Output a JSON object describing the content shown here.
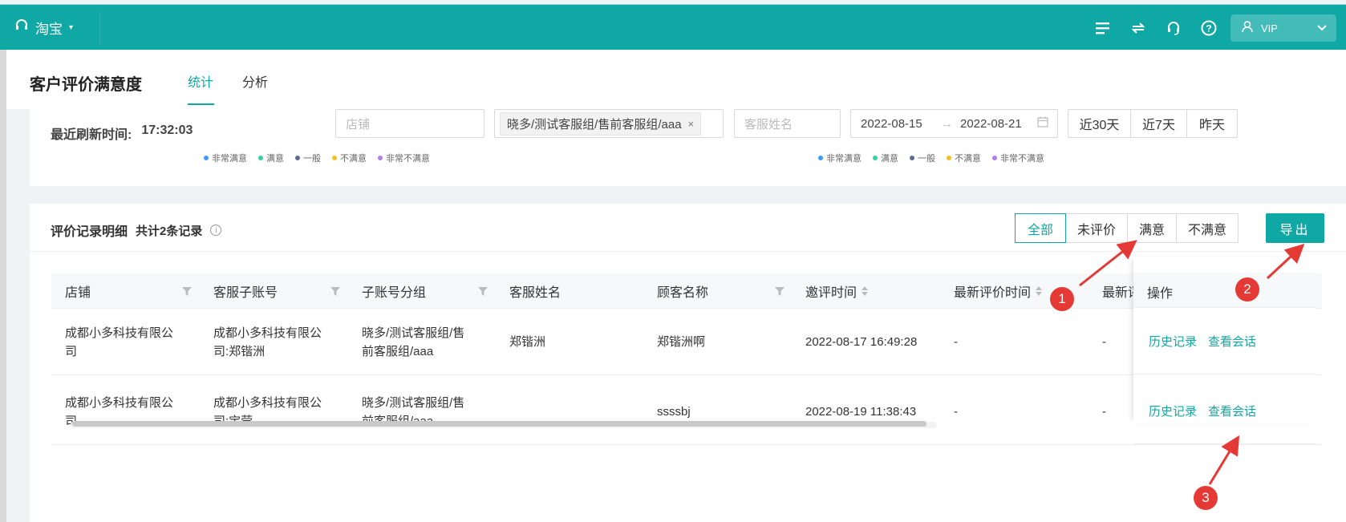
{
  "topbar": {
    "brand": "淘宝",
    "icons": [
      "list-icon",
      "swap-icon",
      "headset-icon",
      "help-icon"
    ],
    "user": "VIP",
    "color": "#0fa8a5"
  },
  "header": {
    "title": "客户评价满意度",
    "tabs": [
      {
        "label": "统计",
        "active": true
      },
      {
        "label": "分析",
        "active": false
      }
    ]
  },
  "filters": {
    "refresh_label": "最近刷新时间:",
    "refresh_time": "17:32:03",
    "shop_placeholder": "店铺",
    "group_tag": "晓多/测试客服组/售前客服组/aaa",
    "agent_placeholder": "客服姓名",
    "date_start": "2022-08-15",
    "date_arrow": "→",
    "date_end": "2022-08-21",
    "quick_ranges": [
      "近30天",
      "近7天",
      "昨天"
    ],
    "legend_left": [
      {
        "label": "非常满意",
        "color": "#3b9bff"
      },
      {
        "label": "满意",
        "color": "#36cfa5"
      },
      {
        "label": "一般",
        "color": "#5b6f96"
      },
      {
        "label": "不满意",
        "color": "#f6c022"
      },
      {
        "label": "非常不满意",
        "color": "#b07ee8"
      }
    ],
    "legend_right": [
      {
        "label": "非常满意",
        "color": "#3b9bff"
      },
      {
        "label": "满意",
        "color": "#36cfa5"
      },
      {
        "label": "一般",
        "color": "#5b6f96"
      },
      {
        "label": "不满意",
        "color": "#f6c022"
      },
      {
        "label": "非常不满意",
        "color": "#b07ee8"
      }
    ]
  },
  "records": {
    "title": "评价记录明细",
    "count": "共计2条记录",
    "segments": [
      {
        "label": "全部",
        "active": true
      },
      {
        "label": "未评价",
        "active": false
      },
      {
        "label": "满意",
        "active": false
      },
      {
        "label": "不满意",
        "active": false
      }
    ],
    "export_label": "导出",
    "columns": [
      "店铺",
      "客服子账号",
      "子账号分组",
      "客服姓名",
      "顾客名称",
      "邀评时间",
      "最新评价时间",
      "最新评",
      "操作"
    ],
    "rows": [
      {
        "shop": [
          "成都小多科技有限公",
          "司"
        ],
        "account": [
          "成都小多科技有限公",
          "司:郑锴洲"
        ],
        "group": [
          "晓多/测试客服组/售",
          "前客服组/aaa"
        ],
        "agent": "郑锴洲",
        "customer": "郑锴洲啊",
        "invite_time": "2022-08-17 16:49:28",
        "latest_time": "-",
        "latest_rating": "-",
        "ops": [
          "历史记录",
          "查看会话"
        ]
      },
      {
        "shop": [
          "成都小多科技有限公",
          "司"
        ],
        "account": [
          "成都小多科技有限公",
          "司:宝莹"
        ],
        "group": [
          "晓多/测试客服组/售",
          "前客服组/aaa"
        ],
        "agent": "",
        "customer": "ssssbj",
        "invite_time": "2022-08-19 11:38:43",
        "latest_time": "-",
        "latest_rating": "-",
        "ops": [
          "历史记录",
          "查看会话"
        ]
      }
    ]
  },
  "annotations": [
    "1",
    "2",
    "3"
  ]
}
